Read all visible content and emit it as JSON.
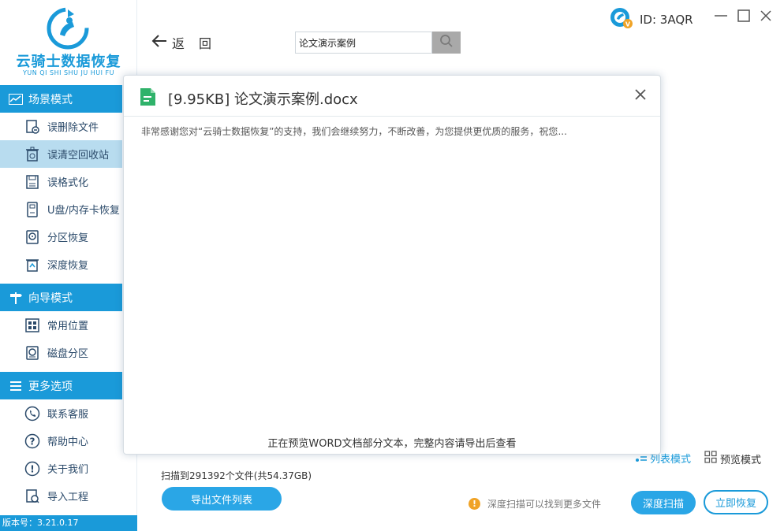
{
  "app": {
    "name": "云骑士数据恢复",
    "pinyin": "YUN QI SHI SHU JU HUI FU",
    "version": "版本号：3.21.0.17"
  },
  "sidebar": {
    "sections": [
      {
        "title": "场景模式",
        "icon": "chart-icon",
        "items": [
          {
            "label": "误删除文件",
            "icon": "deleted-file-icon",
            "active": false
          },
          {
            "label": "误清空回收站",
            "icon": "recycle-bin-icon",
            "active": true
          },
          {
            "label": "误格式化",
            "icon": "floppy-icon",
            "active": false
          },
          {
            "label": "U盘/内存卡恢复",
            "icon": "usb-card-icon",
            "active": false
          },
          {
            "label": "分区恢复",
            "icon": "partition-icon",
            "active": false
          },
          {
            "label": "深度恢复",
            "icon": "trash-deep-icon",
            "active": false
          }
        ]
      },
      {
        "title": "向导模式",
        "icon": "signpost-icon",
        "items": [
          {
            "label": "常用位置",
            "icon": "windows-icon",
            "active": false
          },
          {
            "label": "磁盘分区",
            "icon": "disk-icon",
            "active": false
          }
        ]
      },
      {
        "title": "更多选项",
        "icon": "menu-icon",
        "items": [
          {
            "label": "联系客服",
            "icon": "phone-icon",
            "active": false
          },
          {
            "label": "帮助中心",
            "icon": "help-icon",
            "active": false
          },
          {
            "label": "关于我们",
            "icon": "info-icon",
            "active": false
          },
          {
            "label": "导入工程",
            "icon": "import-icon",
            "active": false
          }
        ]
      }
    ]
  },
  "header": {
    "back_label": "返回",
    "search": {
      "value": "论文演示案例",
      "placeholder": ""
    },
    "user_id": "ID: 3AQR"
  },
  "modal": {
    "title": "[9.95KB] 论文演示案例.docx",
    "preview_text": "非常感谢您对“云骑士数据恢复”的支持，我们会继续努力，不断改善，为您提供更优质的服务，祝您...",
    "footer_note": "正在预览WORD文档部分文本，完整内容请导出后查看"
  },
  "bottom": {
    "mode_list": "列表模式",
    "mode_preview": "预览模式",
    "scan_info": "扫描到291392个文件(共54.37GB)",
    "export_label": "导出文件列表",
    "hint": "深度扫描可以找到更多文件",
    "deep_scan_label": "深度扫描",
    "restore_label": "立即恢复"
  },
  "colors": {
    "accent": "#1a9ad9",
    "active_item": "#b8dcef",
    "button": "#2aa6e6",
    "warning": "#f0a326",
    "doc_green": "#2fb26a"
  }
}
